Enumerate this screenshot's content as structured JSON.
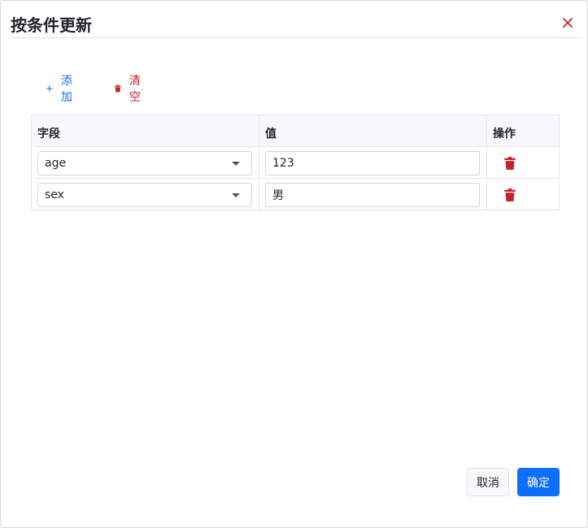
{
  "dialog": {
    "title": "按条件更新"
  },
  "toolbar": {
    "add_label": "添加",
    "clear_label": "清空"
  },
  "grid": {
    "columns": [
      "字段",
      "值",
      "操作"
    ],
    "rows": [
      {
        "field": "age",
        "value": "123"
      },
      {
        "field": "sex",
        "value": "男"
      }
    ]
  },
  "footer": {
    "cancel_label": "取消",
    "confirm_label": "确定"
  },
  "colors": {
    "primary": "#0d6efd",
    "danger": "#c4232d",
    "header_bg": "#f7f8fa",
    "border": "#e3e6ea"
  },
  "icons": {
    "close": "close-icon",
    "add": "plus-icon",
    "clear": "trash-icon",
    "row_delete": "trash-icon",
    "select": "caret-down-icon"
  }
}
